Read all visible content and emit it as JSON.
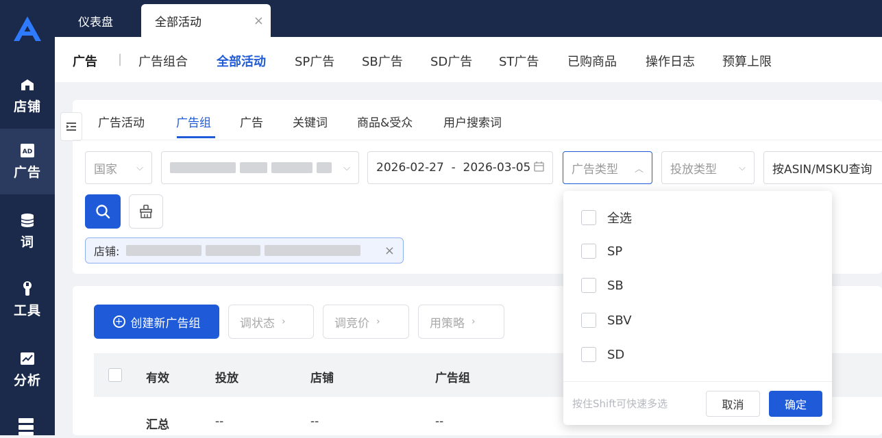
{
  "sidebar": {
    "items": [
      {
        "label": "店铺",
        "icon": "store-icon"
      },
      {
        "label": "广告",
        "icon": "ad-icon"
      },
      {
        "label": "词",
        "icon": "database-icon"
      },
      {
        "label": "工具",
        "icon": "wrench-icon"
      },
      {
        "label": "分析",
        "icon": "chart-icon"
      }
    ]
  },
  "top_tabs": {
    "dashboard": "仪表盘",
    "all_activities": "全部活动",
    "close": "×"
  },
  "subnav": {
    "items": [
      "广告",
      "广告组合",
      "全部活动",
      "SP广告",
      "SB广告",
      "SD广告",
      "ST广告",
      "已购商品",
      "操作日志",
      "预算上限"
    ],
    "active": "全部活动"
  },
  "inner_tabs": {
    "items": [
      "广告活动",
      "广告组",
      "广告",
      "关键词",
      "商品&受众",
      "用户搜索词"
    ],
    "active": "广告组"
  },
  "filters": {
    "country": "国家",
    "date_range": "2026-02-27  -  2026-03-05",
    "ad_type": "广告类型",
    "delivery_type": "投放类型",
    "asin_query": "按ASIN/MSKU查询"
  },
  "store_tag": {
    "label": "店铺:",
    "close": "×"
  },
  "actions": {
    "create": "创建新广告组",
    "adjust_status": "调状态",
    "adjust_bid": "调竞价",
    "apply_strategy": "用策略"
  },
  "table": {
    "headers": [
      "有效",
      "投放",
      "店铺",
      "广告组"
    ],
    "summary_row": [
      "汇总",
      "--",
      "--",
      "--"
    ]
  },
  "ad_type_dropdown": {
    "options": [
      "全选",
      "SP",
      "SB",
      "SBV",
      "SD"
    ],
    "hint": "按住Shift可快速多选",
    "cancel": "取消",
    "confirm": "确定"
  },
  "colors": {
    "primary": "#1f5bd9",
    "sidebar_bg": "#1b2a4a",
    "page_bg": "#f0f2f5"
  }
}
